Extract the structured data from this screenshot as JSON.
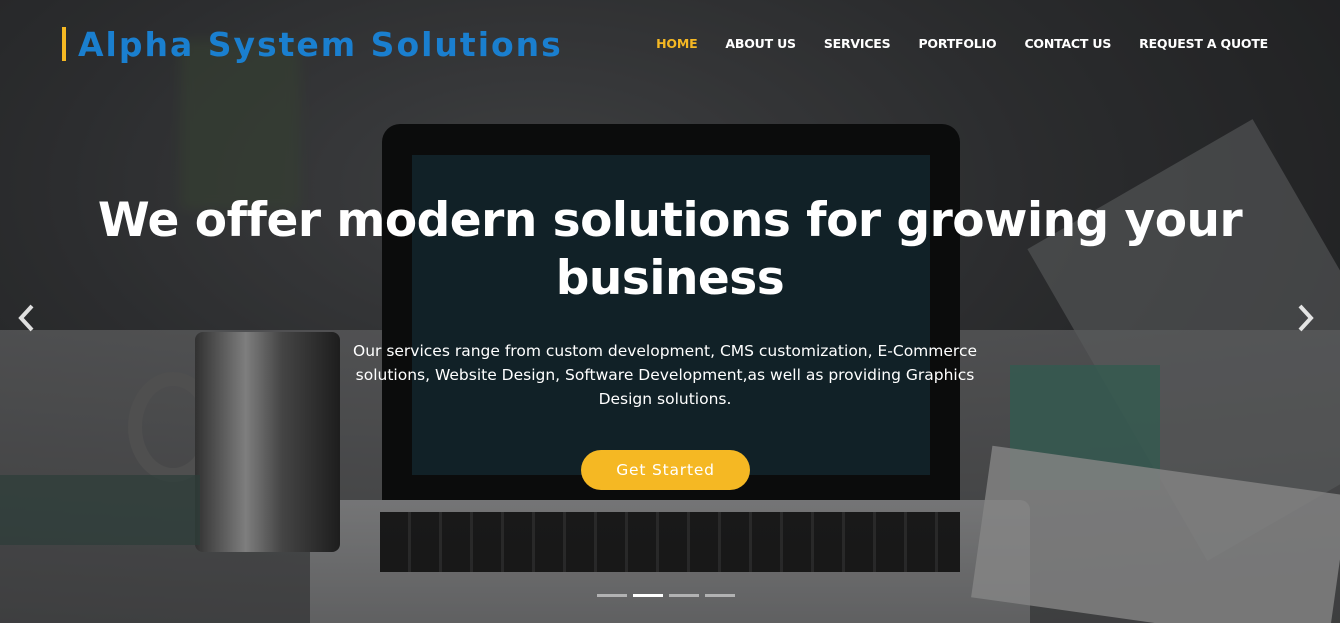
{
  "brand": {
    "name": "Alpha System Solutions",
    "accent_color": "#f5b823",
    "brand_color": "#1a7fcf"
  },
  "nav": {
    "items": [
      {
        "label": "HOME",
        "active": true
      },
      {
        "label": "ABOUT US",
        "active": false
      },
      {
        "label": "SERVICES",
        "active": false
      },
      {
        "label": "PORTFOLIO",
        "active": false
      },
      {
        "label": "CONTACT US",
        "active": false
      },
      {
        "label": "REQUEST A QUOTE",
        "active": false
      }
    ]
  },
  "hero": {
    "headline_line1": "We offer modern solutions for growing your",
    "headline_line2": "business",
    "description": "Our services range from custom development, CMS customization, E-Commerce solutions, Website Design, Software Development,as well as providing Graphics Design solutions.",
    "cta_label": "Get Started"
  },
  "carousel": {
    "prev_icon": "chevron-left-icon",
    "next_icon": "chevron-right-icon",
    "slide_count": 4,
    "active_slide": 2
  }
}
